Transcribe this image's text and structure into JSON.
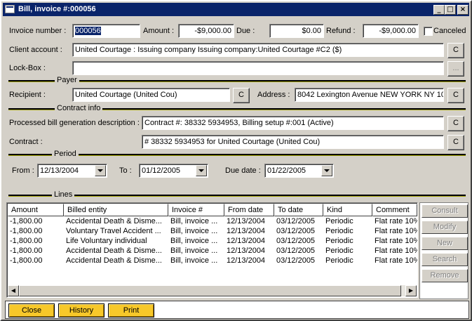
{
  "window": {
    "title": "Bill, invoice #:000056",
    "controls": {
      "minimize": "_",
      "restore": "□",
      "close": "×"
    }
  },
  "header": {
    "invoice_number_label": "Invoice number :",
    "invoice_number_value": "000056",
    "amount_label": "Amount :",
    "amount_value": "-$9,000.00",
    "due_label": "Due :",
    "due_value": "$0.00",
    "refund_label": "Refund :",
    "refund_value": "-$9,000.00",
    "canceled_label": "Canceled",
    "canceled_checked": false,
    "client_account_label": "Client account :",
    "client_account_value": "United Courtage : Issuing company Issuing company:United Courtage #C2 ($)",
    "lockbox_label": "Lock-Box :",
    "lockbox_value": "",
    "c_button": "C",
    "ellipsis_button": "..."
  },
  "payer": {
    "section_title": "Payer",
    "recipient_label": "Recipient :",
    "recipient_value": "United Courtage (United Cou)",
    "address_label": "Address :",
    "address_value": "8042 Lexington Avenue  NEW YORK NY 10"
  },
  "contract_info": {
    "section_title": "Contract info",
    "processed_label": "Processed bill generation description :",
    "processed_value": "Contract #: 38332 5934953, Billing setup #:001 (Active)",
    "contract_label": "Contract :",
    "contract_value": "# 38332 5934953 for United Courtage (United Cou)"
  },
  "period": {
    "section_title": "Period",
    "from_label": "From :",
    "from_value": "12/13/2004",
    "to_label": "To :",
    "to_value": "01/12/2005",
    "due_date_label": "Due date :",
    "due_date_value": "01/22/2005"
  },
  "lines": {
    "section_title": "Lines",
    "columns": [
      "Amount",
      "Billed entity",
      "Invoice #",
      "From date",
      "To date",
      "Kind",
      "Comment"
    ],
    "rows": [
      [
        "-1,800.00",
        "Accidental Death & Disme...",
        "Bill, invoice ...",
        "12/13/2004",
        "03/12/2005",
        "Periodic",
        "Flat rate 10%"
      ],
      [
        "-1,800.00",
        "Voluntary Travel Accident ...",
        "Bill, invoice ...",
        "12/13/2004",
        "03/12/2005",
        "Periodic",
        "Flat rate 10%"
      ],
      [
        "-1,800.00",
        "Life Voluntary individual",
        "Bill, invoice ...",
        "12/13/2004",
        "03/12/2005",
        "Periodic",
        "Flat rate 10%"
      ],
      [
        "-1,800.00",
        "Accidental Death & Disme...",
        "Bill, invoice ...",
        "12/13/2004",
        "03/12/2005",
        "Periodic",
        "Flat rate 10%"
      ],
      [
        "-1,800.00",
        "Accidental Death & Disme...",
        "Bill, invoice ...",
        "12/13/2004",
        "03/12/2005",
        "Periodic",
        "Flat rate 10%"
      ]
    ],
    "side_buttons": [
      "Consult",
      "Modify",
      "New",
      "Search",
      "Remove"
    ]
  },
  "footer": {
    "close": "Close",
    "history": "History",
    "print": "Print"
  },
  "colors": {
    "titlebar": "#0a246a",
    "footer_button": "#f7c82a",
    "window_bg": "#d4d0c8"
  }
}
